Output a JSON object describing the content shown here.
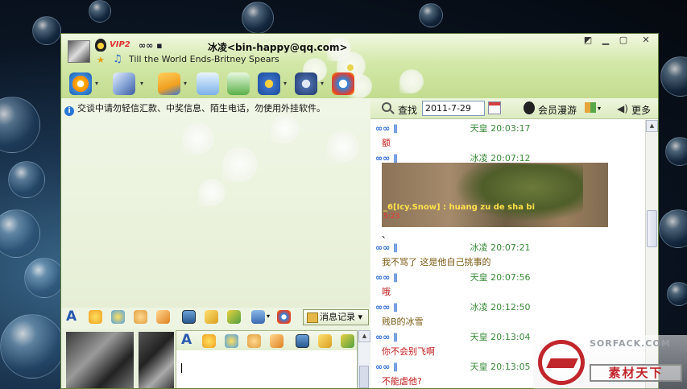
{
  "window": {
    "title": "冰凌<bin-happy@qq.com>",
    "vip_badge": "VIP2",
    "status_glyph": "∞∞ ▪",
    "song": "Till the World Ends-Britney Spears"
  },
  "notice": {
    "text": "交谈中请勿轻信汇款、中奖信息、陌生电话，勿使用外挂软件。"
  },
  "history_toolbar": {
    "search_label": "查找",
    "date_value": "2011-7-29",
    "member_label": "会员漫游",
    "more_label": "更多"
  },
  "format_toolbar": {
    "font_glyph": "A",
    "record_label": "消息记录"
  },
  "input_toolbar": {
    "font_glyph": "A"
  },
  "messages": [
    {
      "sender": "天皇",
      "time": "20:03:17",
      "text": "额",
      "color": "#c01818"
    },
    {
      "sender": "冰凌",
      "time": "20:07:12",
      "text": "",
      "color": "#111111"
    },
    {
      "sender": "冰凌",
      "time": "20:07:21",
      "text": "我不骂了 这是他自己挑事的",
      "color": "#7a5a10"
    },
    {
      "sender": "天皇",
      "time": "20:07:56",
      "text": "哦",
      "color": "#c01818"
    },
    {
      "sender": "冰凌",
      "time": "20:12:50",
      "text": "贱B的冰雪",
      "color": "#7a5a10"
    },
    {
      "sender": "天皇",
      "time": "20:13:04",
      "text": "你不会别飞啊",
      "color": "#c01818"
    },
    {
      "sender": "天皇",
      "time": "20:13:05",
      "text": "不能虐他?",
      "color": "#c01818"
    }
  ],
  "message_head_glyph": "∞∞ ∥",
  "chat_image": {
    "overlay_text": "_6[Icy.Snow] : huang zu de sha bi",
    "overlay_time": "5:23"
  },
  "watermark": {
    "top": "SORFACK.COM",
    "text": "素材天下"
  },
  "colors": {
    "title_gradient_top": "#f1f8e2",
    "title_gradient_bottom": "#c2dc8f",
    "sender_green": "#3a8a3a",
    "glyph_blue": "#2a6ad0"
  }
}
